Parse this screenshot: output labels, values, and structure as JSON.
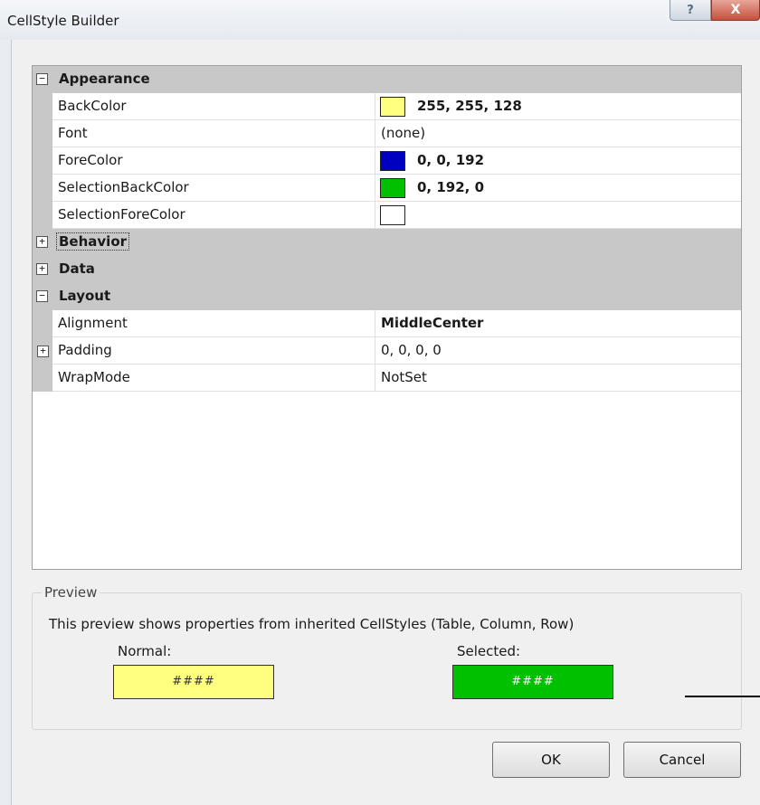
{
  "window": {
    "title": "CellStyle Builder",
    "help_label": "?",
    "close_label": "X"
  },
  "grid": {
    "categories": {
      "appearance": {
        "label": "Appearance",
        "toggle": "−"
      },
      "behavior": {
        "label": "Behavior",
        "toggle": "+"
      },
      "data": {
        "label": "Data",
        "toggle": "+"
      },
      "layout": {
        "label": "Layout",
        "toggle": "−"
      }
    },
    "appearance": {
      "backcolor": {
        "name": "BackColor",
        "value": "255, 255, 128",
        "swatch": "#ffff80"
      },
      "font": {
        "name": "Font",
        "value": "(none)"
      },
      "forecolor": {
        "name": "ForeColor",
        "value": "0, 0, 192",
        "swatch": "#0000c0"
      },
      "selbackcolor": {
        "name": "SelectionBackColor",
        "value": "0, 192, 0",
        "swatch": "#00c000"
      },
      "selforecolor": {
        "name": "SelectionForeColor",
        "value": "",
        "swatch": "#ffffff"
      }
    },
    "layout": {
      "alignment": {
        "name": "Alignment",
        "value": "MiddleCenter"
      },
      "padding": {
        "name": "Padding",
        "value": "0, 0, 0, 0",
        "toggle": "+"
      },
      "wrapmode": {
        "name": "WrapMode",
        "value": "NotSet"
      }
    }
  },
  "preview": {
    "legend": "Preview",
    "description": "This preview shows properties from inherited CellStyles (Table, Column, Row)",
    "normal_label": "Normal:",
    "selected_label": "Selected:",
    "normal_text": "####",
    "selected_text": "####",
    "normal_color": "#ffff80",
    "selected_color": "#00c000"
  },
  "buttons": {
    "ok": "OK",
    "cancel": "Cancel"
  }
}
